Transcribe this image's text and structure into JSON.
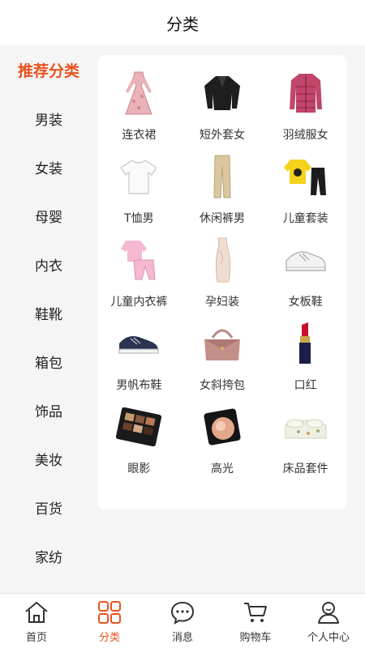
{
  "header": {
    "title": "分类"
  },
  "sidebar": {
    "items": [
      {
        "label": "推荐分类",
        "active": true
      },
      {
        "label": "男装"
      },
      {
        "label": "女装"
      },
      {
        "label": "母婴"
      },
      {
        "label": "内衣"
      },
      {
        "label": "鞋靴"
      },
      {
        "label": "箱包"
      },
      {
        "label": "饰品"
      },
      {
        "label": "美妆"
      },
      {
        "label": "百货"
      },
      {
        "label": "家纺"
      }
    ]
  },
  "grid": {
    "items": [
      {
        "label": "连衣裙",
        "icon": "dress-icon"
      },
      {
        "label": "短外套女",
        "icon": "cardigan-icon"
      },
      {
        "label": "羽绒服女",
        "icon": "down-jacket-icon"
      },
      {
        "label": "T恤男",
        "icon": "tshirt-icon"
      },
      {
        "label": "休闲裤男",
        "icon": "pants-icon"
      },
      {
        "label": "儿童套装",
        "icon": "kids-set-icon"
      },
      {
        "label": "儿童内衣裤",
        "icon": "kids-underwear-icon"
      },
      {
        "label": "孕妇装",
        "icon": "maternity-dress-icon"
      },
      {
        "label": "女板鞋",
        "icon": "sneaker-icon"
      },
      {
        "label": "男帆布鞋",
        "icon": "canvas-shoe-icon"
      },
      {
        "label": "女斜挎包",
        "icon": "handbag-icon"
      },
      {
        "label": "口红",
        "icon": "lipstick-icon"
      },
      {
        "label": "眼影",
        "icon": "eyeshadow-icon"
      },
      {
        "label": "高光",
        "icon": "highlighter-icon"
      },
      {
        "label": "床品套件",
        "icon": "bedding-icon"
      }
    ]
  },
  "tabbar": {
    "items": [
      {
        "label": "首页",
        "icon": "home-icon"
      },
      {
        "label": "分类",
        "icon": "category-icon",
        "active": true
      },
      {
        "label": "消息",
        "icon": "message-icon"
      },
      {
        "label": "购物车",
        "icon": "cart-icon"
      },
      {
        "label": "个人中心",
        "icon": "profile-icon"
      }
    ]
  },
  "colors": {
    "accent": "#e8531e",
    "background": "#f5f5f5",
    "panel": "#ffffff"
  }
}
